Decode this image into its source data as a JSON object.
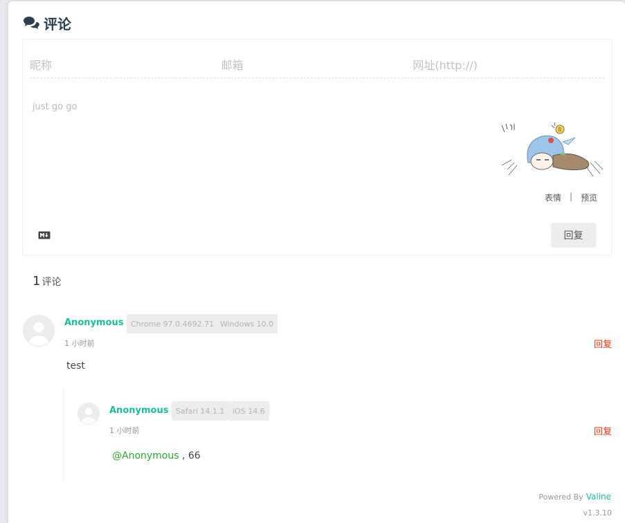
{
  "header": {
    "title": "评论"
  },
  "form": {
    "nick_placeholder": "昵称",
    "mail_placeholder": "邮箱",
    "link_placeholder": "网址(http://)",
    "editor_placeholder": "just go go",
    "emoji_label": "表情",
    "separator": "|",
    "preview_label": "预览",
    "submit_label": "回复"
  },
  "summary": {
    "count": "1",
    "label": "评论"
  },
  "comments": [
    {
      "nick": "Anonymous",
      "browser": "Chrome 97.0.4692.71",
      "os": "Windows 10.0",
      "time": "1 小时前",
      "reply_label": "回复",
      "content": "test",
      "replies": [
        {
          "nick": "Anonymous",
          "browser": "Safari 14.1.1",
          "os": "iOS 14.6",
          "time": "1 小时前",
          "reply_label": "回复",
          "at": "@Anonymous",
          "content": " , 66"
        }
      ]
    }
  ],
  "footer": {
    "powered": "Powered By",
    "brand": "Valine",
    "version": "v1.3.10"
  },
  "colors": {
    "nick": "#1abc9c",
    "reply": "#ef2f11",
    "at": "#2aa932",
    "title": "#2c3e50"
  },
  "icons": [
    "comments-icon",
    "markdown-icon",
    "avatar-icon",
    "mascot-image"
  ]
}
